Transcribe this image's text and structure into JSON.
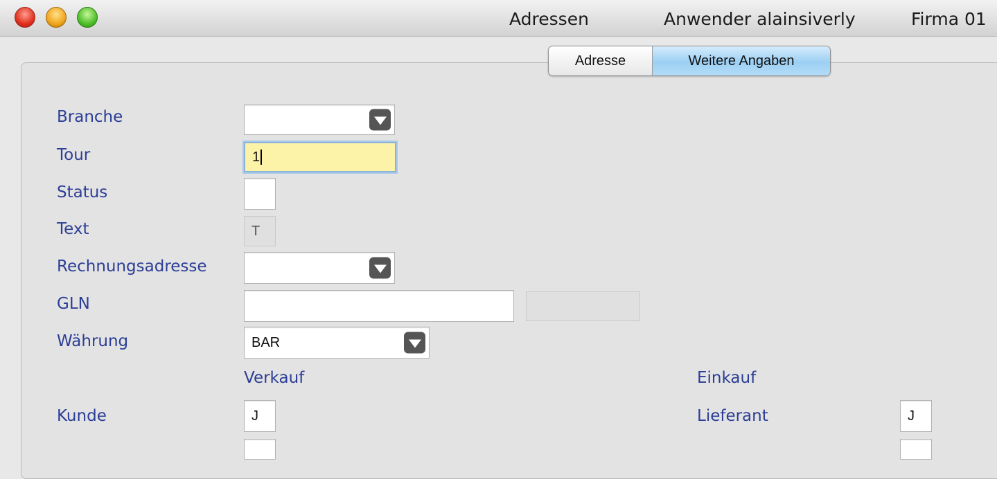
{
  "window": {
    "title": "Adressen",
    "user": "Anwender alainsiverly",
    "company": "Firma 01"
  },
  "tabs": [
    {
      "label": "Adresse",
      "active": false
    },
    {
      "label": "Weitere Angaben",
      "active": true
    }
  ],
  "form": {
    "branche": {
      "label": "Branche",
      "value": ""
    },
    "tour": {
      "label": "Tour",
      "value": "1"
    },
    "status": {
      "label": "Status",
      "value": ""
    },
    "text": {
      "label": "Text",
      "value": "T"
    },
    "rechnungsadresse": {
      "label": "Rechnungsadresse",
      "value": ""
    },
    "gln": {
      "label": "GLN",
      "value": "",
      "extra_value": ""
    },
    "waehrung": {
      "label": "Währung",
      "value": "BAR"
    },
    "verkauf_heading": "Verkauf",
    "einkauf_heading": "Einkauf",
    "kunde": {
      "label": "Kunde",
      "value": "J"
    },
    "lieferant": {
      "label": "Lieferant",
      "value": "J"
    }
  },
  "colors": {
    "label": "#2c3e96",
    "focused_field": "#fdf3a8",
    "active_tab": "#9ccff3"
  }
}
